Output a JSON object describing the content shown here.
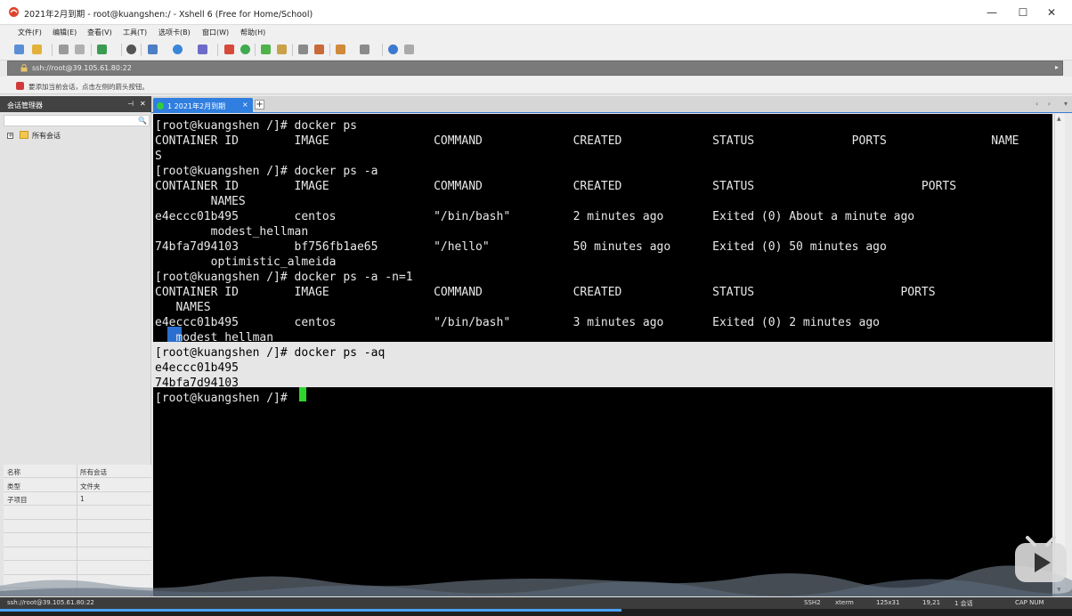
{
  "window": {
    "title": "2021年2月到期 - root@kuangshen:/ - Xshell 6 (Free for Home/School)",
    "min": "—",
    "max": "☐",
    "close": "✕"
  },
  "menu": [
    "文件(F)",
    "编辑(E)",
    "查看(V)",
    "工具(T)",
    "选项卡(B)",
    "窗口(W)",
    "帮助(H)"
  ],
  "address": {
    "text": "ssh://root@39.105.61.80:22",
    "arrow": "▸"
  },
  "info": {
    "text": "要添加当前会话，点击左侧的箭头按钮。"
  },
  "sidebar": {
    "title": "会话管理器",
    "pin": "⊣",
    "close": "✕",
    "search_icon": "🔍",
    "tree_toggle": "+",
    "tree_root": "所有会话",
    "properties": [
      {
        "key": "名称",
        "value": "所有会话"
      },
      {
        "key": "类型",
        "value": "文件夹"
      },
      {
        "key": "子项目",
        "value": "1"
      },
      {
        "key": "",
        "value": ""
      },
      {
        "key": "",
        "value": ""
      },
      {
        "key": "",
        "value": ""
      },
      {
        "key": "",
        "value": ""
      },
      {
        "key": "",
        "value": ""
      },
      {
        "key": "",
        "value": ""
      }
    ]
  },
  "tabs": {
    "active_label": "1 2021年2月到期",
    "close": "×",
    "add": "+",
    "nav": "‹ ›",
    "menu": "▾"
  },
  "terminal": {
    "lines": [
      "[root@kuangshen /]# docker ps",
      "CONTAINER ID        IMAGE               COMMAND             CREATED             STATUS              PORTS               NAME",
      "S",
      "[root@kuangshen /]# docker ps -a",
      "CONTAINER ID        IMAGE               COMMAND             CREATED             STATUS                        PORTS",
      "        NAMES",
      "e4eccc01b495        centos              \"/bin/bash\"         2 minutes ago       Exited (0) About a minute ago",
      "        modest_hellman",
      "74bfa7d94103        bf756fb1ae65        \"/hello\"            50 minutes ago      Exited (0) 50 minutes ago",
      "        optimistic_almeida",
      "[root@kuangshen /]# docker ps -a -n=1",
      "CONTAINER ID        IMAGE               COMMAND             CREATED             STATUS                     PORTS",
      "   NAMES",
      "e4eccc01b495        centos              \"/bin/bash\"         3 minutes ago       Exited (0) 2 minutes ago",
      "   modest_hellman",
      "[root@kuangshen /]# docker ps -aq",
      "e4eccc01b495",
      "74bfa7d94103",
      "[root@kuangshen /]# "
    ]
  },
  "status": {
    "address": "ssh://root@39.105.61.80:22",
    "protocol": "SSH2",
    "term": "xterm",
    "size": "125x31",
    "position": "19,21",
    "sessions": "1 会话",
    "caps": "CAP NUM"
  },
  "player": {
    "progress": 0.58
  },
  "colors": {
    "accent": "#2f7ee0",
    "terminal_bg": "#000000",
    "cursor": "#2ed32e",
    "selection": "#e6e6e6"
  }
}
